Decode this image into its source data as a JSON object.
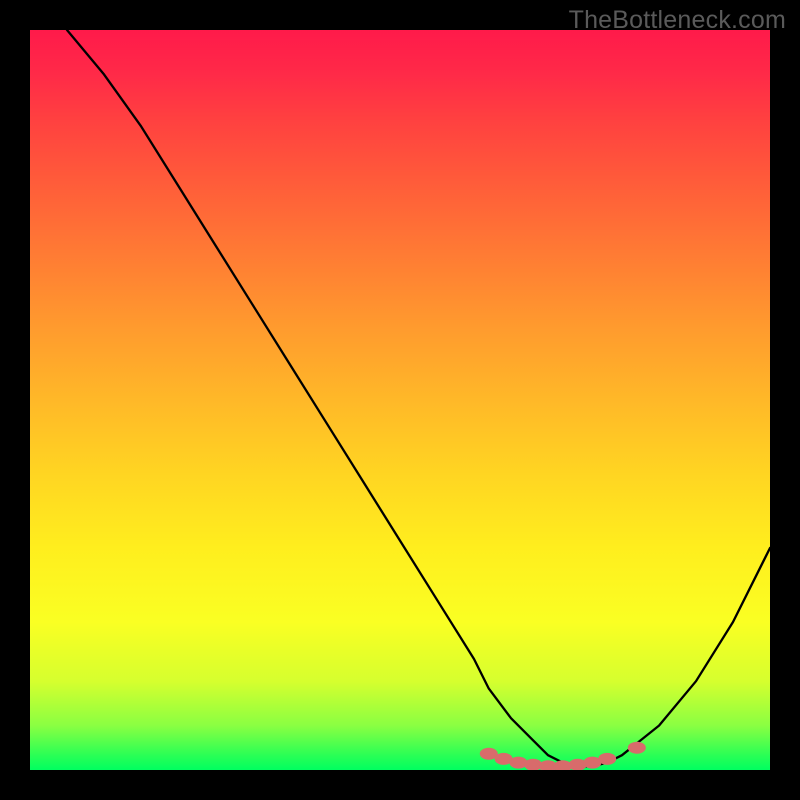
{
  "watermark": "TheBottleneck.com",
  "chart_data": {
    "type": "line",
    "title": "",
    "xlabel": "",
    "ylabel": "",
    "xlim": [
      0,
      100
    ],
    "ylim": [
      0,
      100
    ],
    "series": [
      {
        "name": "curve",
        "x": [
          5,
          10,
          15,
          20,
          25,
          30,
          35,
          40,
          45,
          50,
          55,
          60,
          62,
          65,
          68,
          70,
          72,
          74,
          76,
          78,
          80,
          85,
          90,
          95,
          100
        ],
        "y": [
          100,
          94,
          87,
          79,
          71,
          63,
          55,
          47,
          39,
          31,
          23,
          15,
          11,
          7,
          4,
          2,
          1,
          0.5,
          0.5,
          1,
          2,
          6,
          12,
          20,
          30
        ]
      }
    ],
    "markers": {
      "name": "highlight-dots",
      "color": "#d86b6b",
      "points": [
        {
          "x": 62,
          "y": 2.2
        },
        {
          "x": 64,
          "y": 1.5
        },
        {
          "x": 66,
          "y": 1.0
        },
        {
          "x": 68,
          "y": 0.7
        },
        {
          "x": 70,
          "y": 0.5
        },
        {
          "x": 72,
          "y": 0.5
        },
        {
          "x": 74,
          "y": 0.7
        },
        {
          "x": 76,
          "y": 1.0
        },
        {
          "x": 78,
          "y": 1.5
        },
        {
          "x": 82,
          "y": 3.0
        }
      ]
    }
  }
}
